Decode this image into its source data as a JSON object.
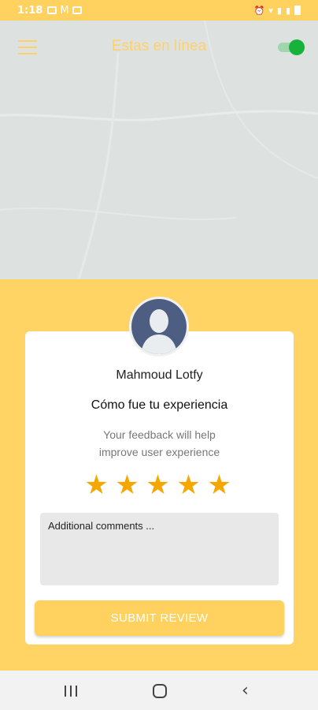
{
  "status_bar": {
    "time": "1:18"
  },
  "header": {
    "title": "Estas en línea",
    "online_toggle_on": true
  },
  "review": {
    "driver_name": "Mahmoud Lotfy",
    "question": "Cómo fue tu experiencia",
    "hint_line1": "Your feedback will help",
    "hint_line2": "improve user experience",
    "rating_stars": 5,
    "comments_placeholder": "Additional comments ...",
    "submit_label": "SUBMIT REVIEW"
  },
  "colors": {
    "accent_yellow": "#ffd15e",
    "star": "#f5a700",
    "toggle_on": "#17b23a"
  },
  "icons": {
    "menu": "hamburger-menu-icon",
    "toggle": "switch-icon",
    "avatar": "user-silhouette-icon",
    "star": "star-icon",
    "nav_recent": "recent-apps-icon",
    "nav_home": "home-icon",
    "nav_back": "back-chevron-icon"
  }
}
